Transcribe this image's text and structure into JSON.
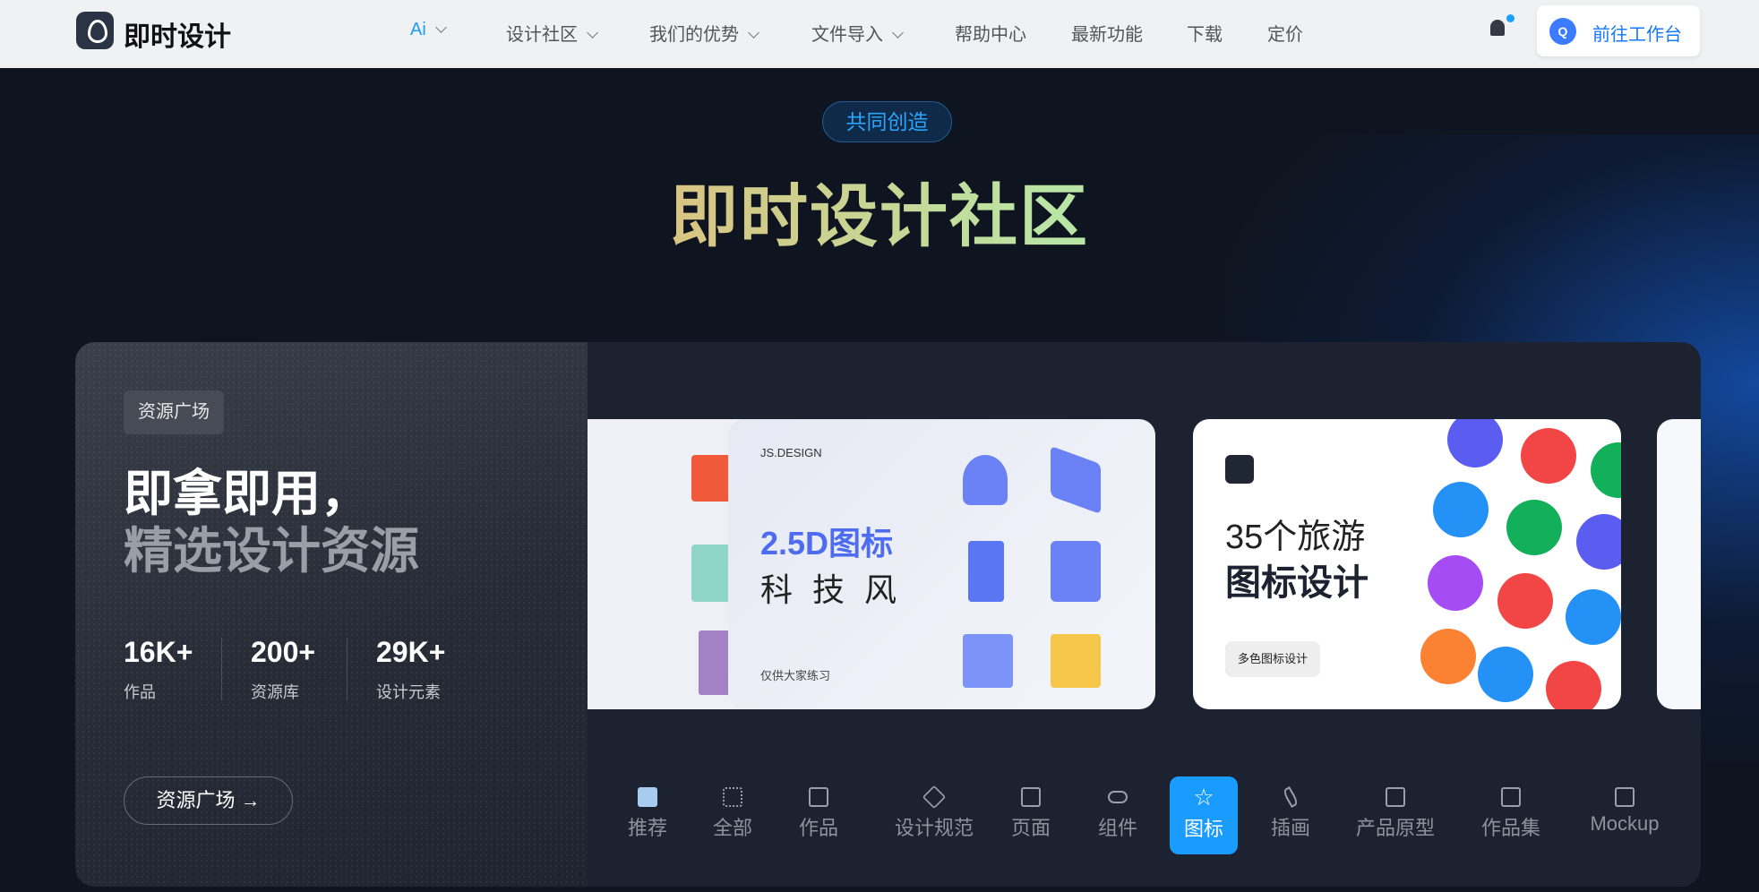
{
  "nav": {
    "logo": "即时设计",
    "items": [
      {
        "label": "Ai",
        "dropdown": true,
        "active": true
      },
      {
        "label": "设计社区",
        "dropdown": true
      },
      {
        "label": "我们的优势",
        "dropdown": true
      },
      {
        "label": "文件导入",
        "dropdown": true
      },
      {
        "label": "帮助中心"
      },
      {
        "label": "最新功能"
      },
      {
        "label": "下载"
      },
      {
        "label": "定价"
      }
    ],
    "avatar_letter": "Q",
    "workspace_button": "前往工作台",
    "accent": "#1677ff"
  },
  "hero": {
    "pill": "共同创造",
    "title": "即时设计社区"
  },
  "panel": {
    "tag": "资源广场",
    "headline1": "即拿即用，",
    "headline2": "精选设计资源",
    "stats": [
      {
        "value": "16K+",
        "label": "作品"
      },
      {
        "value": "200+",
        "label": "资源库"
      },
      {
        "value": "29K+",
        "label": "设计元素"
      }
    ],
    "button": "资源广场 →"
  },
  "cards": {
    "card2": {
      "brand": "JS.DESIGN",
      "title": "2.5D图标",
      "subtitle": "科 技 风",
      "note": "仅供大家练习"
    },
    "card3": {
      "line1": "35个旅游",
      "line2": "图标设计",
      "badge": "多色图标设计"
    }
  },
  "tabs": [
    {
      "label": "推荐",
      "icon": "bookmark-icon"
    },
    {
      "label": "全部",
      "icon": "grid-icon"
    },
    {
      "label": "作品",
      "icon": "scroll-icon"
    },
    {
      "label": "设计规范",
      "icon": "cube-icon"
    },
    {
      "label": "页面",
      "icon": "page-icon"
    },
    {
      "label": "组件",
      "icon": "toggle-icon"
    },
    {
      "label": "图标",
      "icon": "star-icon",
      "active": true
    },
    {
      "label": "插画",
      "icon": "feather-icon"
    },
    {
      "label": "产品原型",
      "icon": "layout-icon"
    },
    {
      "label": "作品集",
      "icon": "briefcase-icon"
    },
    {
      "label": "Mockup",
      "icon": "monitor-icon"
    }
  ]
}
